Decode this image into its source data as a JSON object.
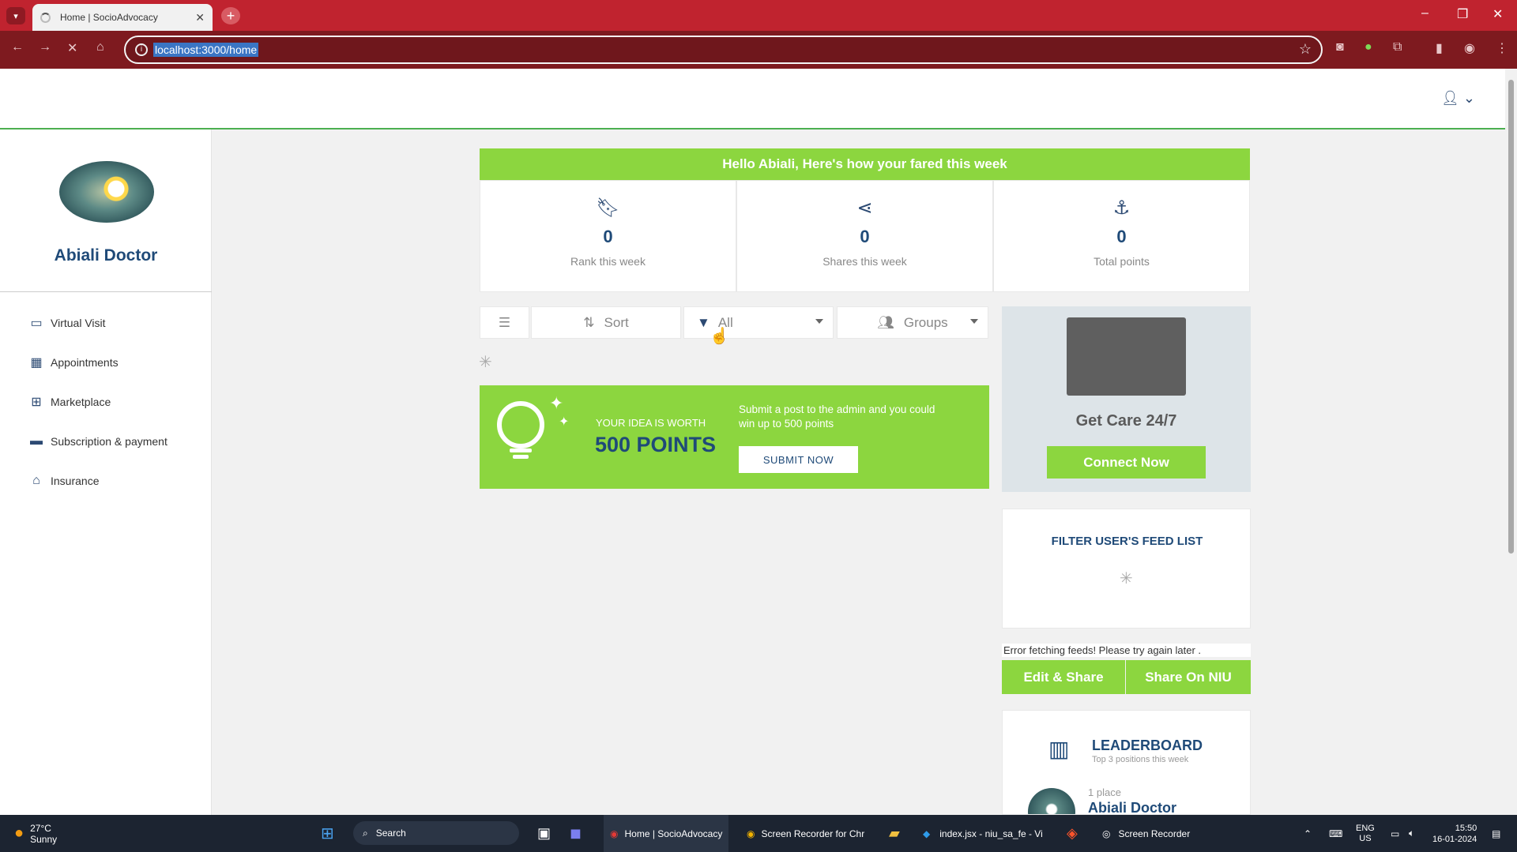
{
  "browser": {
    "tab_title": "Home | SocioAdvocacy",
    "url": "localhost:3000/home"
  },
  "profile": {
    "name": "Abiali Doctor"
  },
  "sidebar": {
    "items": [
      {
        "label": "Virtual Visit",
        "icon": "video-icon"
      },
      {
        "label": "Appointments",
        "icon": "calendar-icon"
      },
      {
        "label": "Marketplace",
        "icon": "medical-bag-icon"
      },
      {
        "label": "Subscription & payment",
        "icon": "credit-card-icon"
      },
      {
        "label": "Insurance",
        "icon": "home-shield-icon"
      }
    ]
  },
  "weekly": {
    "banner": "Hello Abiali, Here's how your fared this week",
    "stats": [
      {
        "value": "0",
        "label": "Rank this week",
        "icon": "bookmark-icon"
      },
      {
        "value": "0",
        "label": "Shares this week",
        "icon": "share-icon"
      },
      {
        "value": "0",
        "label": "Total points",
        "icon": "anchor-icon"
      }
    ]
  },
  "controls": {
    "sort": "Sort",
    "filter": "All",
    "groups": "Groups"
  },
  "promo": {
    "worth": "YOUR IDEA IS WORTH",
    "points": "500 POINTS",
    "desc": "Submit a post to the admin and you could win up to 500 points",
    "button": "SUBMIT NOW"
  },
  "care": {
    "title": "Get Care 24/7",
    "button": "Connect Now"
  },
  "filter_card": {
    "title": "FILTER USER'S FEED LIST"
  },
  "error": "Error fetching feeds! Please try again later .",
  "share": {
    "edit": "Edit & Share",
    "niu": "Share On NIU"
  },
  "leaderboard": {
    "title": "LEADERBOARD",
    "subtitle": "Top 3 positions this week",
    "place": "1 place",
    "name": "Abiali Doctor"
  },
  "taskbar": {
    "weather_temp": "27°C",
    "weather_text": "Sunny",
    "search": "Search",
    "apps": [
      "Home | SocioAdvocacy",
      "Screen Recorder for Chr",
      "index.jsx - niu_sa_fe - Vi",
      "Screen Recorder"
    ],
    "lang1": "ENG",
    "lang2": "US",
    "time": "15:50",
    "date": "16-01-2024"
  },
  "colors": {
    "accent_green": "#8cd63f",
    "brand_blue": "#1f4a78",
    "browser_red": "#c0232f"
  }
}
